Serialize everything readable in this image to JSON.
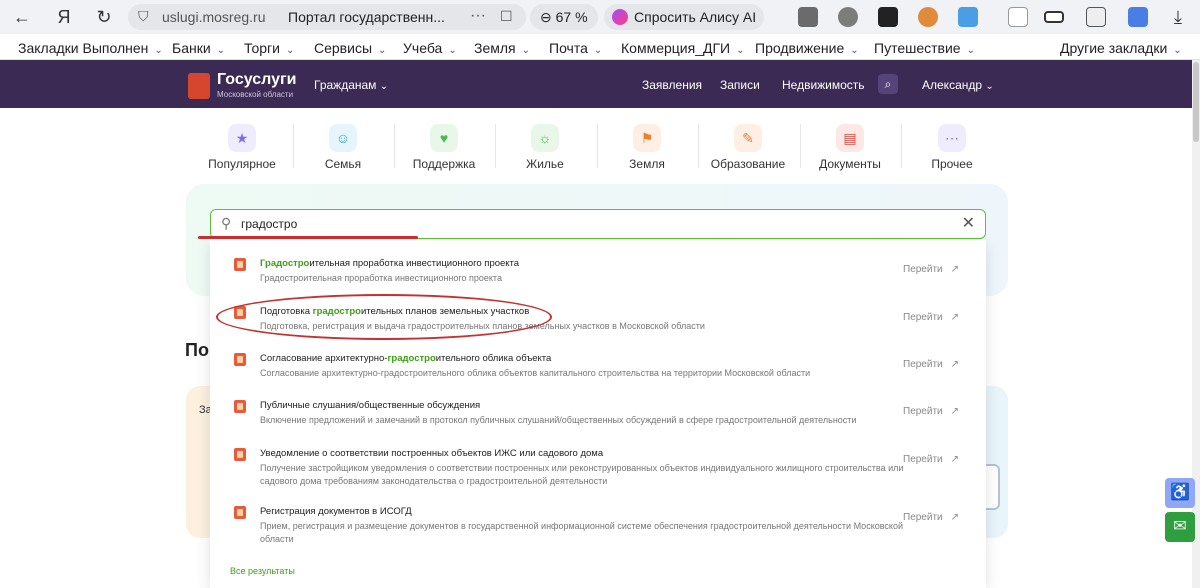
{
  "browser": {
    "url_host": "uslugi.mosreg.ru",
    "tab_title": "Портал государственн...",
    "zoom": "67 %",
    "alice_label": "Спросить Алису AI"
  },
  "bookmarks": [
    {
      "label": "Закладки Выполнен",
      "chevron": true
    },
    {
      "label": "Банки",
      "chevron": true
    },
    {
      "label": "Торги",
      "chevron": true
    },
    {
      "label": "Сервисы",
      "chevron": true
    },
    {
      "label": "Учеба",
      "chevron": true
    },
    {
      "label": "Земля",
      "chevron": true
    },
    {
      "label": "Почта",
      "chevron": true
    },
    {
      "label": "Коммерция_ДГИ",
      "chevron": true
    },
    {
      "label": "Продвижение",
      "chevron": true
    },
    {
      "label": "Путешествие",
      "chevron": true
    },
    {
      "label": "Другие закладки",
      "chevron": true
    }
  ],
  "site": {
    "logo_name": "Госуслуги",
    "logo_sub": "Московской области",
    "nav_citizens": "Гражданам",
    "nav_links": [
      "Заявления",
      "Записи",
      "Недвижимость"
    ],
    "user": "Александр"
  },
  "categories": [
    {
      "label": "Популярное",
      "icon": "star-icon",
      "color": "#7b6cf0",
      "bg": "#efedfd",
      "glyph": "★"
    },
    {
      "label": "Семья",
      "icon": "family-icon",
      "color": "#2aa8d8",
      "bg": "#e6f5fb",
      "glyph": "☺"
    },
    {
      "label": "Поддержка",
      "icon": "support-icon",
      "color": "#4cb84c",
      "bg": "#e9f7e9",
      "glyph": "♥"
    },
    {
      "label": "Жилье",
      "icon": "housing-icon",
      "color": "#4cb84c",
      "bg": "#e9f7e9",
      "glyph": "☼"
    },
    {
      "label": "Земля",
      "icon": "land-icon",
      "color": "#f07c2c",
      "bg": "#fdefe3",
      "glyph": "⚑"
    },
    {
      "label": "Образование",
      "icon": "education-icon",
      "color": "#f07c2c",
      "bg": "#fdefe3",
      "glyph": "✎"
    },
    {
      "label": "Документы",
      "icon": "documents-icon",
      "color": "#e0453a",
      "bg": "#fde8e6",
      "glyph": "▤"
    },
    {
      "label": "Прочее",
      "icon": "more-icon",
      "color": "#7b6cf0",
      "bg": "#efedfd",
      "glyph": "⋯"
    }
  ],
  "search": {
    "query": "градостро",
    "results": [
      {
        "pre": "",
        "hl": "Градостро",
        "post": "ительная проработка инвестиционного проекта",
        "desc": "Градостроительная проработка инвестиционного проекта",
        "action": "Перейти"
      },
      {
        "pre": "Подготовка ",
        "hl": "градостро",
        "post": "ительных планов земельных участков",
        "desc": "Подготовка, регистрация и выдача градостроительных планов земельных участков в Московской области",
        "action": "Перейти"
      },
      {
        "pre": "Согласование архитектурно-",
        "hl": "градостро",
        "post": "ительного облика объекта",
        "desc": "Согласование архитектурно-градостроительного облика объектов капитального строительства на территории Московской области",
        "action": "Перейти"
      },
      {
        "pre": "Публичные слушания/общественные обсуждения",
        "hl": "",
        "post": "",
        "desc": "Включение предложений и замечаний в протокол публичных слушаний/общественных обсуждений в сфере градостроительной деятельности",
        "action": "Перейти"
      },
      {
        "pre": "Уведомление о соответствии построенных объектов ИЖС или садового дома",
        "hl": "",
        "post": "",
        "desc": "Получение застройщиком уведомления о соответствии построенных или реконструированных объектов индивидуального жилищного строительства или садового дома требованиям законодательства о градостроительной деятельности",
        "action": "Перейти"
      },
      {
        "pre": "Регистрация документов в ИСОГД",
        "hl": "",
        "post": "",
        "desc": "Прием, регистрация и размещение документов в государственной информационной системе обеспечения градостроительной деятельности Московской области",
        "action": "Перейти"
      }
    ],
    "all_results": "Все результаты"
  },
  "background": {
    "heading_fragment": "По",
    "tile_fragment": "За"
  }
}
